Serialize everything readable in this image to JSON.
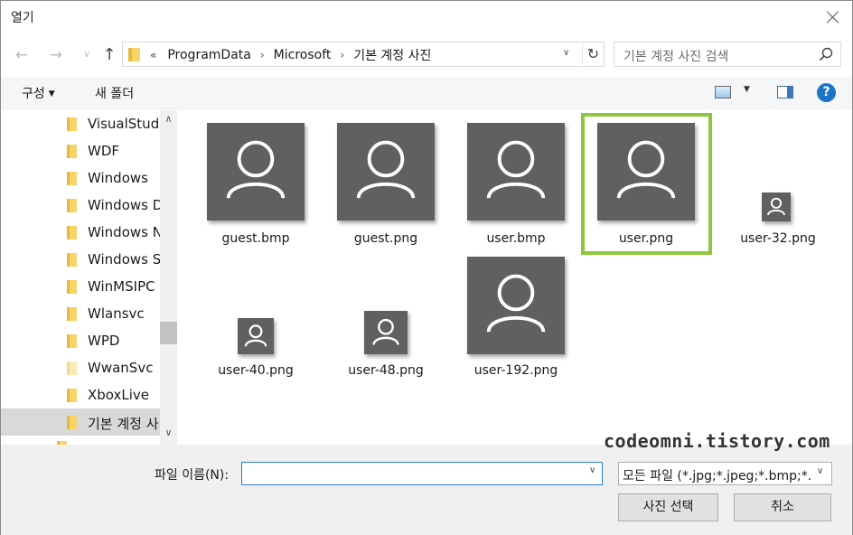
{
  "window": {
    "title": "열기"
  },
  "address": {
    "overflow": "«",
    "crumbs": [
      "ProgramData",
      "Microsoft",
      "기본 계정 사진"
    ]
  },
  "search": {
    "placeholder": "기본 계정 사진 검색"
  },
  "toolbar": {
    "organize": "구성",
    "new_folder": "새 폴더",
    "help": "?"
  },
  "sidebar": {
    "items": [
      {
        "label": "VisualStudio"
      },
      {
        "label": "WDF"
      },
      {
        "label": "Windows"
      },
      {
        "label": "Windows D"
      },
      {
        "label": "Windows N"
      },
      {
        "label": "Windows Se"
      },
      {
        "label": "WinMSIPC"
      },
      {
        "label": "Wlansvc"
      },
      {
        "label": "WPD"
      },
      {
        "label": "WwanSvc"
      },
      {
        "label": "XboxLive"
      },
      {
        "label": "기본 계정 사"
      }
    ],
    "selected_index": 11
  },
  "files": [
    {
      "name": "guest.bmp"
    },
    {
      "name": "guest.png"
    },
    {
      "name": "user.bmp"
    },
    {
      "name": "user.png",
      "selected": true
    },
    {
      "name": "user-32.png"
    },
    {
      "name": "user-40.png"
    },
    {
      "name": "user-48.png"
    },
    {
      "name": "user-192.png"
    }
  ],
  "watermark": "codeomni.tistory.com",
  "bottom": {
    "filename_label": "파일 이름(N):",
    "filename_value": "",
    "filetype": "모든 파일 (*.jpg;*.jpeg;*.bmp;*.d",
    "ok": "사진 선택",
    "cancel": "취소"
  },
  "colors": {
    "selection_border": "#8cc83a",
    "thumb_bg": "#606060",
    "accent": "#2b7cd3"
  }
}
